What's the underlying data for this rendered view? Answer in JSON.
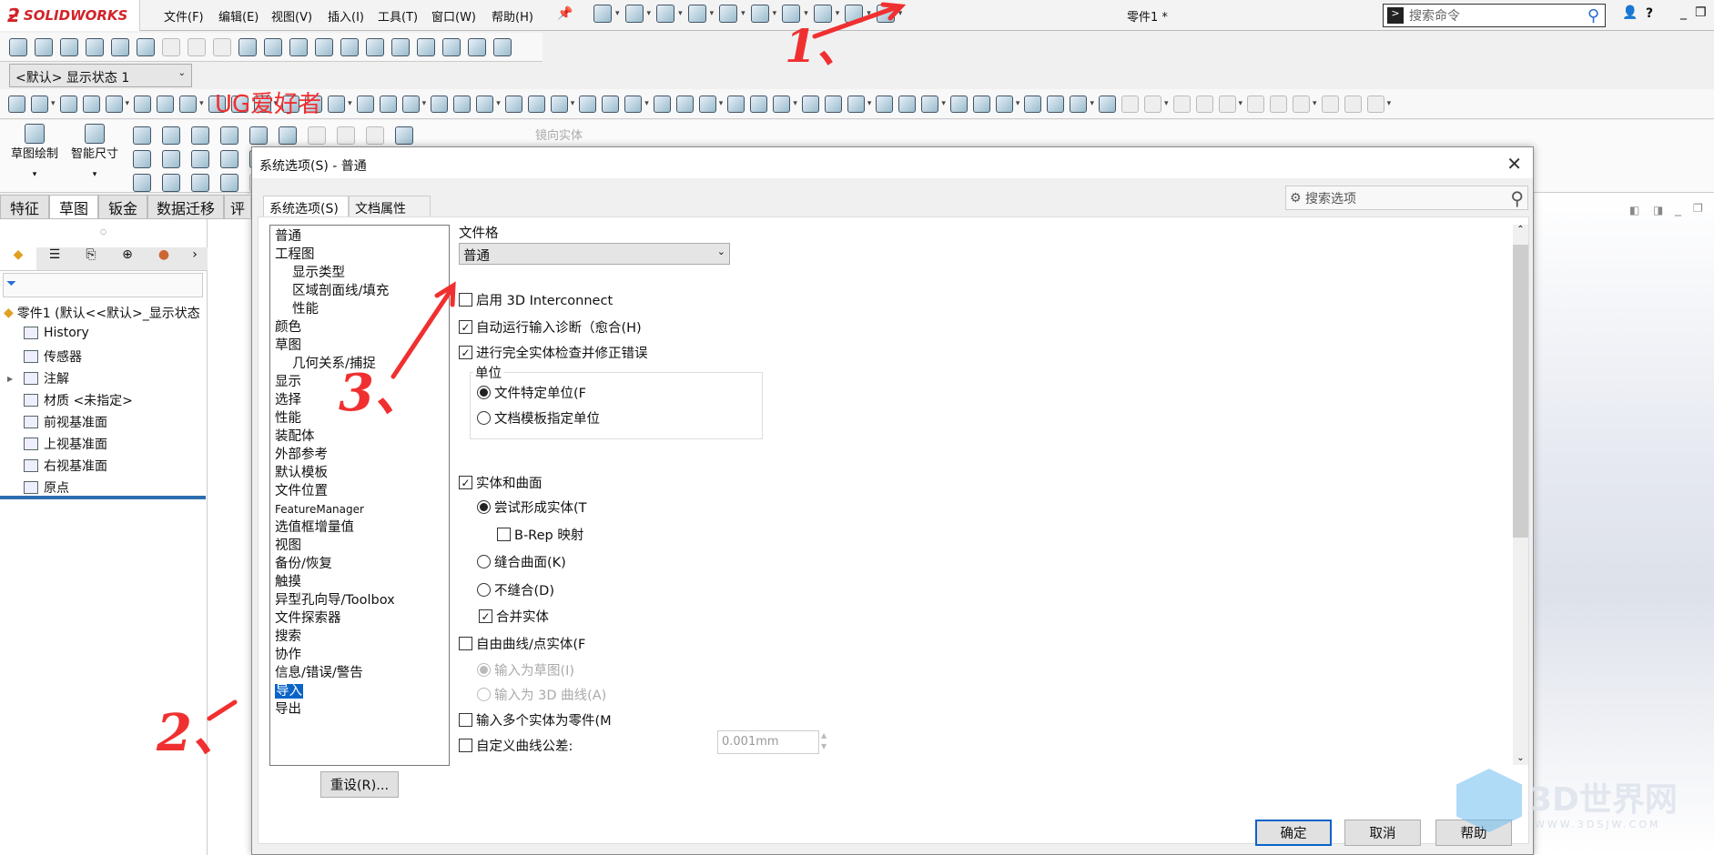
{
  "app": {
    "logo": "SOLIDWORKS",
    "doc_title": "零件1 *"
  },
  "menu": [
    "文件(F)",
    "编辑(E)",
    "视图(V)",
    "插入(I)",
    "工具(T)",
    "窗口(W)",
    "帮助(H)"
  ],
  "quick_toolbar": [
    "home-icon",
    "new-document-icon",
    "open-icon",
    "save-icon",
    "print-icon",
    "undo-icon",
    "select-icon",
    "rebuild-icon",
    "file-properties-icon",
    "options-gear-icon"
  ],
  "search_command": {
    "placeholder": "搜索命令"
  },
  "toolbar2": [
    "spelling-icon",
    "measure-icon",
    "mass-properties-icon",
    "section-properties-icon",
    "sensor-icon",
    "performance-icon",
    "check-icon",
    "geometry-analysis-icon",
    "equations-icon",
    "draft-analysis-icon",
    "symmetry-icon",
    "thickness-icon",
    "deviation-icon",
    "compare-icon",
    "excel-icon",
    "curvature-icon",
    "zebra-icon",
    "verify-icon",
    "color-icon",
    "settings-icon"
  ],
  "display_state": "<默认> 显示状态 1",
  "toolbar3_count_label": "",
  "command_manager": {
    "sketch": "草图绘制",
    "smart_dimension": "智能尺寸",
    "mirror_entities": "镜向实体"
  },
  "cm_tabs": [
    "特征",
    "草图",
    "钣金",
    "数据迁移",
    "评"
  ],
  "active_cm_tab": 1,
  "feature_tree": {
    "root": "零件1 (默认<<默认>_显示状态",
    "items": [
      "History",
      "传感器",
      "注解",
      "材质 <未指定>",
      "前视基准面",
      "上视基准面",
      "右视基准面",
      "原点"
    ]
  },
  "dialog": {
    "title": "系统选项(S) - 普通",
    "tabs": [
      "系统选项(S)",
      "文档属性(D)"
    ],
    "search_placeholder": "搜索选项",
    "categories": [
      {
        "label": "普通"
      },
      {
        "label": "工程图"
      },
      {
        "label": "显示类型",
        "sub": true
      },
      {
        "label": "区域剖面线/填充",
        "sub": true
      },
      {
        "label": "性能",
        "sub": true
      },
      {
        "label": "颜色"
      },
      {
        "label": "草图"
      },
      {
        "label": "几何关系/捕捉",
        "sub": true
      },
      {
        "label": "显示"
      },
      {
        "label": "选择"
      },
      {
        "label": "性能"
      },
      {
        "label": "装配体"
      },
      {
        "label": "外部参考"
      },
      {
        "label": "默认模板"
      },
      {
        "label": "文件位置"
      },
      {
        "label": "FeatureManager"
      },
      {
        "label": "选值框增量值"
      },
      {
        "label": "视图"
      },
      {
        "label": "备份/恢复"
      },
      {
        "label": "触摸"
      },
      {
        "label": "异型孔向导/Toolbox"
      },
      {
        "label": "文件探索器"
      },
      {
        "label": "搜索"
      },
      {
        "label": "协作"
      },
      {
        "label": "信息/错误/警告"
      },
      {
        "label": "导入",
        "selected": true
      },
      {
        "label": "导出"
      }
    ],
    "reset": "重设(R)...",
    "file_format_label": "文件格",
    "file_format_value": "普通",
    "enable_3d_interconnect": {
      "label": "启用 3D Interconnect",
      "checked": false
    },
    "auto_diagnosis": {
      "label": "自动运行输入诊断（愈合(H)",
      "checked": true
    },
    "full_check": {
      "label": "进行完全实体检查并修正错误",
      "checked": true
    },
    "units": {
      "legend": "单位",
      "options": [
        "文件特定单位(F",
        "文档模板指定单位"
      ],
      "selected": 0
    },
    "solids_surfaces": {
      "label": "实体和曲面",
      "checked": true
    },
    "solid_options": {
      "try_solid": "尝试形成实体(T",
      "brep": "B-Rep 映射",
      "knit": "缝合曲面(K)",
      "no_knit": "不缝合(D)",
      "selected": 0,
      "brep_checked": false
    },
    "merge": {
      "label": "合并实体",
      "checked": true
    },
    "free_curves": {
      "label": "自由曲线/点实体(F",
      "checked": false
    },
    "curve_options": {
      "as_sketch": "输入为草图(I)",
      "as_3d": "输入为 3D 曲线(A)",
      "selected": 0
    },
    "multi_body": {
      "label": "输入多个实体为零件(M",
      "checked": false
    },
    "custom_tol": {
      "label": "自定义曲线公差:",
      "checked": false,
      "value": "0.001mm"
    },
    "ok": "确定",
    "cancel": "取消",
    "help": "帮助"
  },
  "annotations": {
    "brand": "UG爱好者",
    "step1": "1、",
    "step2": "2、",
    "step3": "3、",
    "color": "#f03030"
  },
  "watermark": {
    "text": "3D世界网",
    "url_text": "WWW.3DSJW.COM"
  }
}
